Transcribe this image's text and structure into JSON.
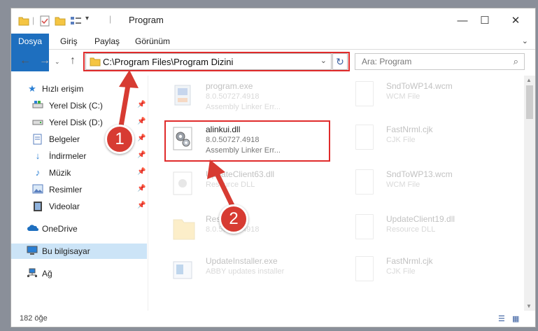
{
  "window": {
    "title": "Program",
    "controls": {
      "minimize": "—",
      "maximize": "☐",
      "close": "✕"
    }
  },
  "ribbon": {
    "tabs": [
      "Dosya",
      "Giriş",
      "Paylaş",
      "Görünüm"
    ],
    "expand": "⌄"
  },
  "nav": {
    "address": "C:\\Program Files\\Program Dizini",
    "search_placeholder": "Ara: Program"
  },
  "sidebar": {
    "items": [
      {
        "label": "Hızlı erişim",
        "icon": "star-icon",
        "pinned": false
      },
      {
        "label": "Yerel Disk (C:)",
        "icon": "drive-icon",
        "pinned": true
      },
      {
        "label": "Yerel Disk (D:)",
        "icon": "drive-icon",
        "pinned": true
      },
      {
        "label": "Belgeler",
        "icon": "documents-icon",
        "pinned": true
      },
      {
        "label": "İndirmeler",
        "icon": "download-icon",
        "pinned": true
      },
      {
        "label": "Müzik",
        "icon": "music-icon",
        "pinned": true
      },
      {
        "label": "Resimler",
        "icon": "pictures-icon",
        "pinned": true
      },
      {
        "label": "Videolar",
        "icon": "video-icon",
        "pinned": true
      },
      {
        "label": "OneDrive",
        "icon": "cloud-icon",
        "pinned": false
      },
      {
        "label": "Bu bilgisayar",
        "icon": "computer-icon",
        "pinned": false
      },
      {
        "label": "Ağ",
        "icon": "network-icon",
        "pinned": false
      }
    ]
  },
  "files": [
    {
      "name": "program.exe",
      "line1": "8.0.50727.4918",
      "line2": "Assembly Linker Err...",
      "icon": "exe-icon"
    },
    {
      "name": "SndToWP14.wcm",
      "line1": "WCM File",
      "line2": "",
      "icon": "doc-icon"
    },
    {
      "name": "alinkui.dll",
      "line1": "8.0.50727.4918",
      "line2": "Assembly Linker Err...",
      "icon": "gear-file-icon"
    },
    {
      "name": "FastNrml.cjk",
      "line1": "CJK File",
      "line2": "",
      "icon": "doc-icon"
    },
    {
      "name": "UpdateClient63.dll",
      "line1": "Resource DLL",
      "line2": "",
      "icon": "dll-icon"
    },
    {
      "name": "SndToWP13.wcm",
      "line1": "WCM File",
      "line2": "",
      "icon": "doc-icon"
    },
    {
      "name": "Resources",
      "line1": "8.0.50727.4918",
      "line2": "",
      "icon": "folder-icon"
    },
    {
      "name": "UpdateClient19.dll",
      "line1": "Resource DLL",
      "line2": "",
      "icon": "doc-icon"
    },
    {
      "name": "UpdateInstaller.exe",
      "line1": "ABBY updates installer",
      "line2": "",
      "icon": "installer-icon"
    },
    {
      "name": "FastNrml.cjk",
      "line1": "CJK File",
      "line2": "",
      "icon": "doc-icon"
    }
  ],
  "status": {
    "count": "182 öğe"
  },
  "annotations": {
    "badge1": "1",
    "badge2": "2"
  },
  "colors": {
    "accent": "#1e6fbf",
    "highlight": "#e02b2b",
    "selected": "#cce4f7"
  }
}
